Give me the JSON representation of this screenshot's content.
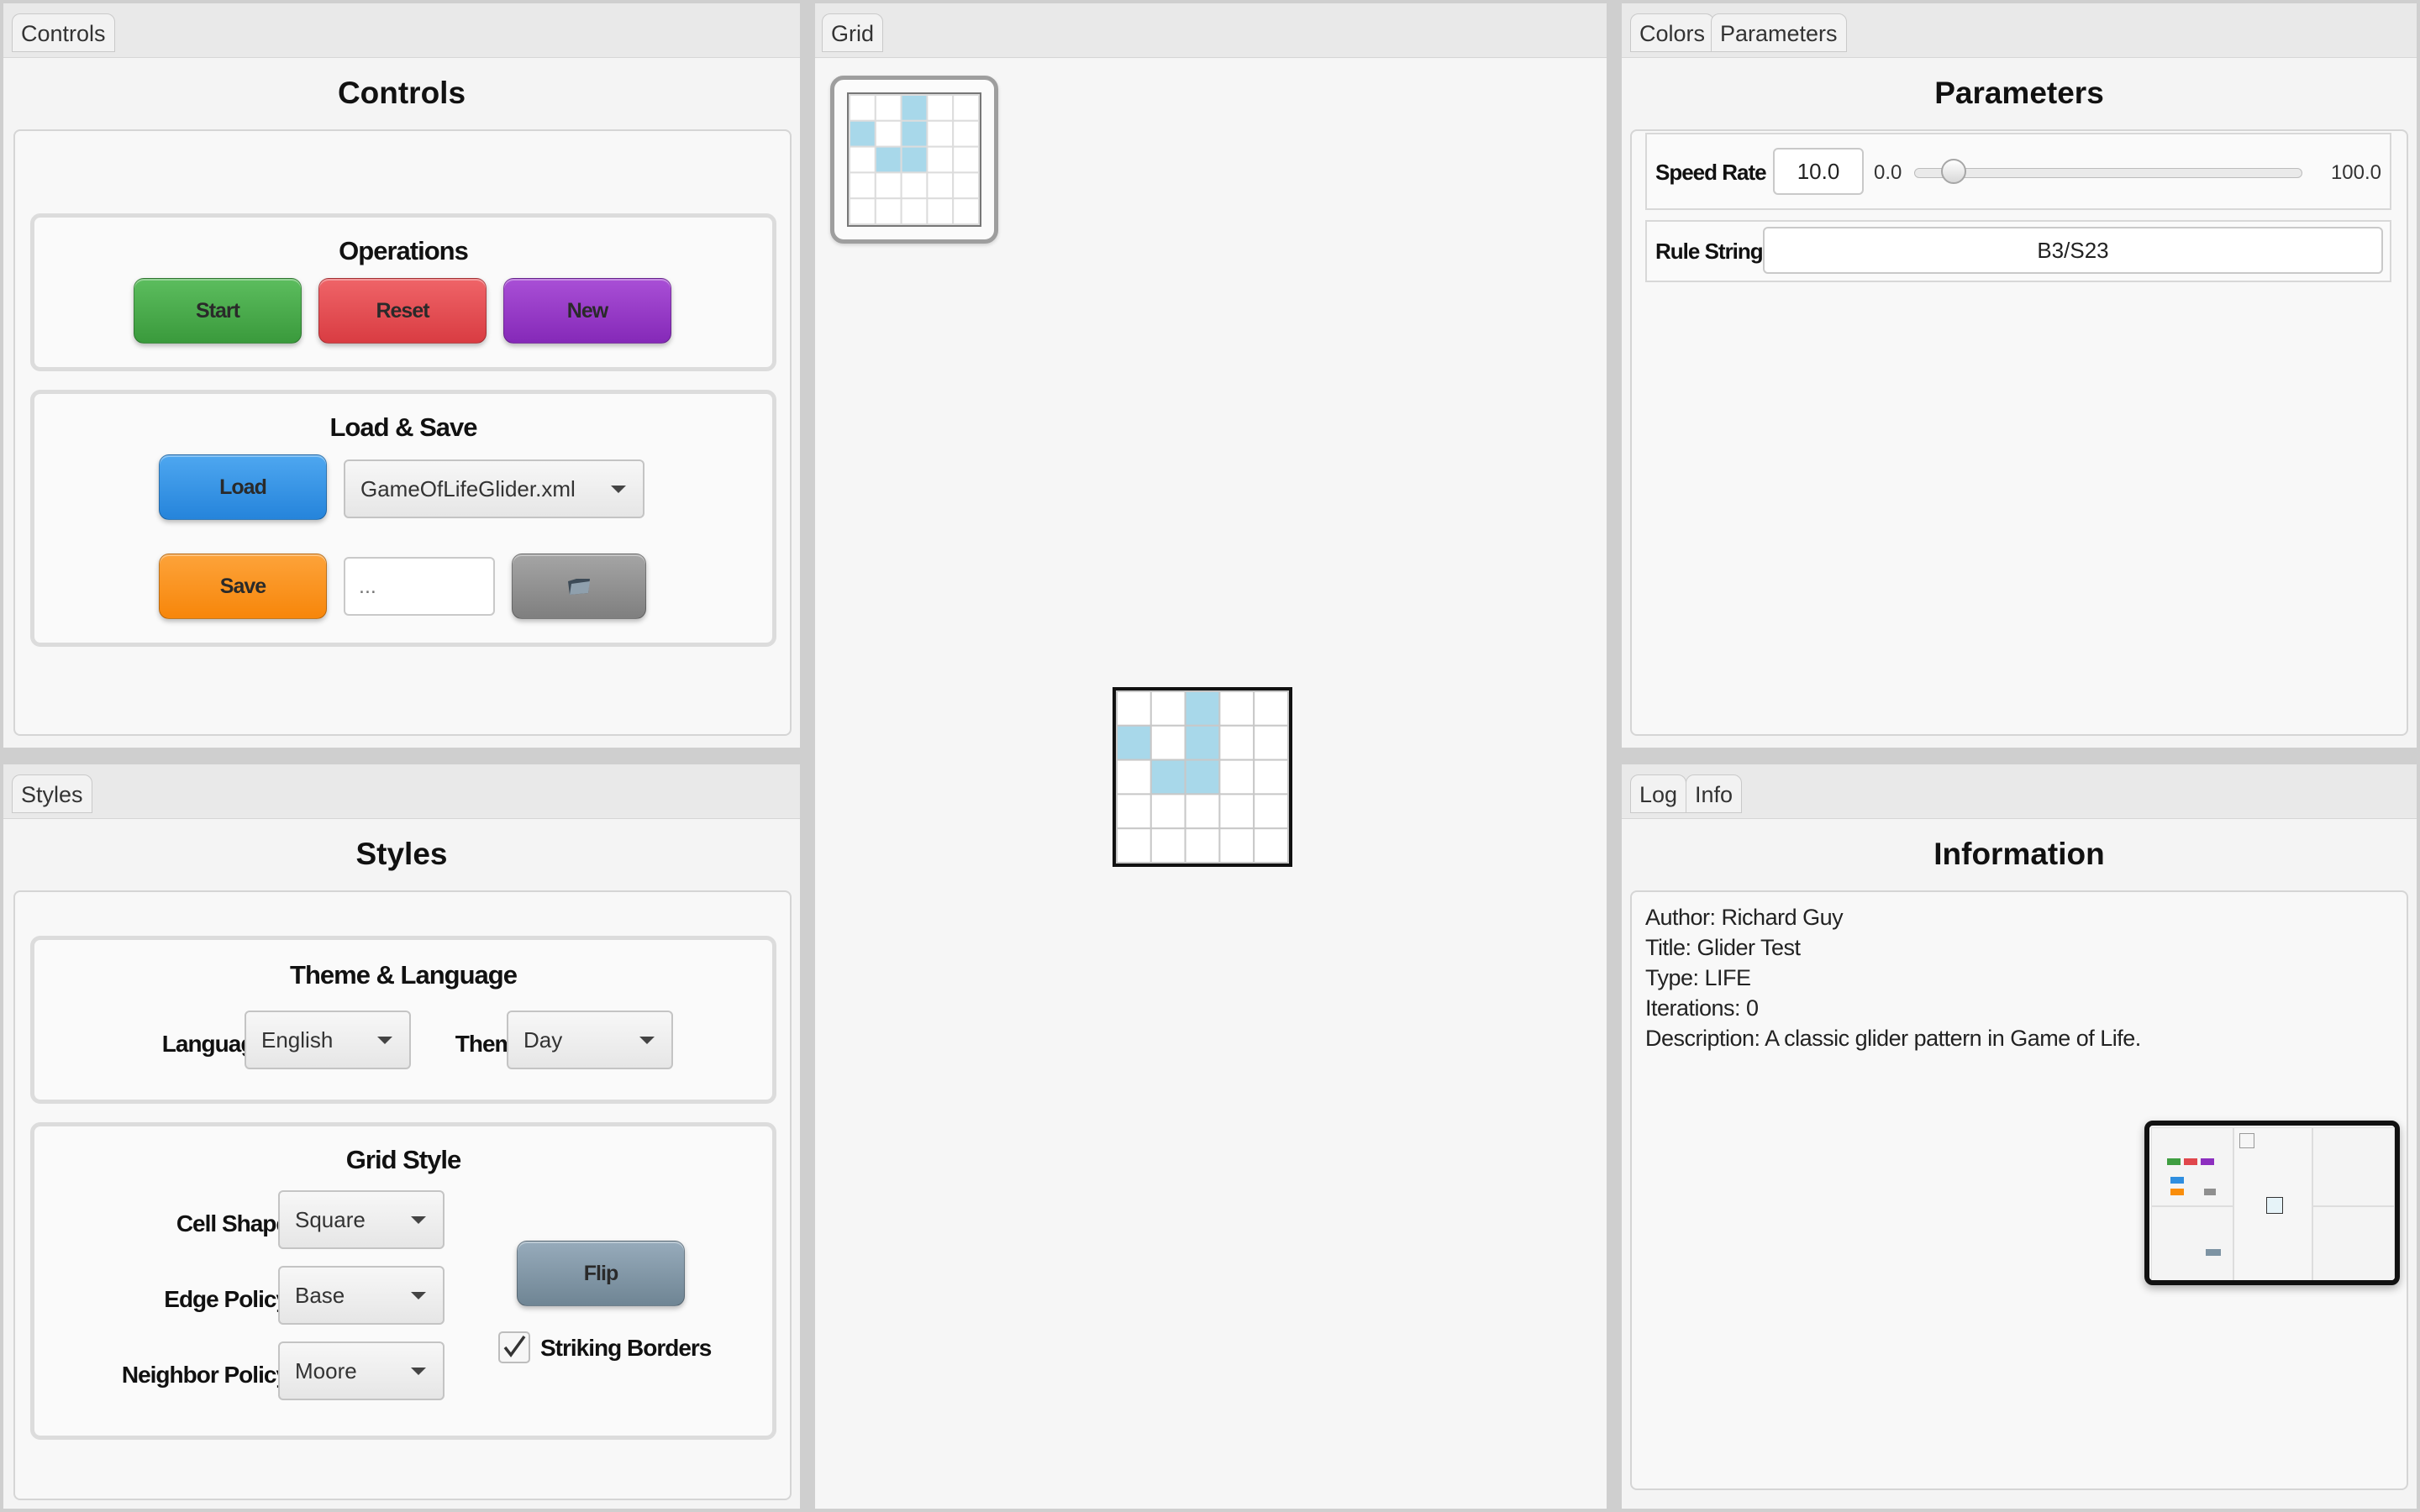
{
  "controls_pane": {
    "tab": "Controls",
    "title": "Controls",
    "operations": {
      "title": "Operations",
      "start_label": "Start",
      "reset_label": "Reset",
      "new_label": "New"
    },
    "load_save": {
      "title": "Load & Save",
      "load_label": "Load",
      "file_value": "GameOfLifeGlider.xml",
      "save_label": "Save",
      "save_name_placeholder": "..."
    }
  },
  "styles_pane": {
    "tab": "Styles",
    "title": "Styles",
    "theme_language": {
      "title": "Theme & Language",
      "language_label": "Language",
      "language_value": "English",
      "theme_label": "Theme",
      "theme_value": "Day"
    },
    "grid_style": {
      "title": "Grid Style",
      "cell_shape_label": "Cell Shape",
      "cell_shape_value": "Square",
      "edge_policy_label": "Edge Policy",
      "edge_policy_value": "Base",
      "neighbor_policy_label": "Neighbor Policy",
      "neighbor_policy_value": "Moore",
      "flip_label": "Flip",
      "striking_borders_label": "Striking Borders",
      "striking_borders_checked": true
    }
  },
  "grid_pane": {
    "tab": "Grid",
    "alive_color": "#a8d8ea",
    "dead_color": "#ffffff",
    "cells": [
      [
        0,
        0,
        1,
        0,
        0
      ],
      [
        1,
        0,
        1,
        0,
        0
      ],
      [
        0,
        1,
        1,
        0,
        0
      ],
      [
        0,
        0,
        0,
        0,
        0
      ],
      [
        0,
        0,
        0,
        0,
        0
      ]
    ]
  },
  "parameters_pane": {
    "tabs": [
      "Colors",
      "Parameters"
    ],
    "title": "Parameters",
    "speed_rate_label": "Speed Rate",
    "speed_rate_value": "10.0",
    "speed_min": "0.0",
    "speed_max": "100.0",
    "speed_fraction": 0.1,
    "rule_string_label": "Rule String",
    "rule_string_value": "B3/S23"
  },
  "info_pane": {
    "tabs": [
      "Log",
      "Info"
    ],
    "title": "Information",
    "lines": [
      "Author: Richard Guy",
      "Title: Glider Test",
      "Type: LIFE",
      "Iterations: 0",
      "Description: A classic glider pattern in Game of Life."
    ]
  },
  "colors": {
    "start": "#3f9e41",
    "reset": "#e0474c",
    "new": "#8d2fbf",
    "load": "#2f8ee0",
    "save": "#f98d0b",
    "folder": "#8f8f8f",
    "flip": "#7d93a3"
  },
  "icons": {
    "folder": "folder-icon",
    "check": "checkmark-icon"
  }
}
